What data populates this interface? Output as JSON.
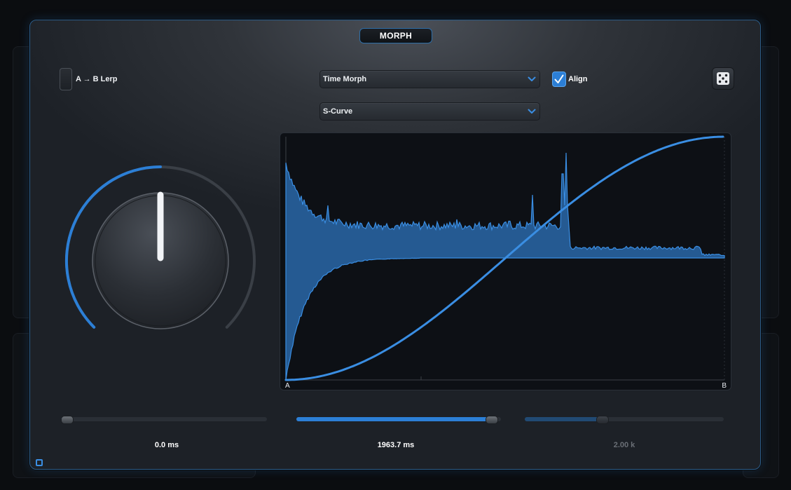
{
  "title": "MORPH",
  "toggle": {
    "label": "A → B Lerp",
    "checked": false
  },
  "dropdowns": {
    "mode": {
      "selected": "Time Morph"
    },
    "curve": {
      "selected": "S-Curve"
    }
  },
  "align": {
    "label": "Align",
    "checked": true
  },
  "randomize": {
    "icon": "dice-icon"
  },
  "knob": {
    "value_fraction": 0.5
  },
  "display": {
    "start_label": "A",
    "end_label": "B"
  },
  "sliders": [
    {
      "value_text": "0.0 ms",
      "fraction": 0.0,
      "enabled": true
    },
    {
      "value_text": "1963.7 ms",
      "fraction": 0.98,
      "enabled": true
    },
    {
      "value_text": "2.00 k",
      "fraction": 0.38,
      "enabled": false
    }
  ],
  "colors": {
    "accent": "#2c7fd6",
    "accent_bright": "#3a8ee3",
    "text": "#ffffff",
    "text_disabled": "#6a6f76"
  }
}
